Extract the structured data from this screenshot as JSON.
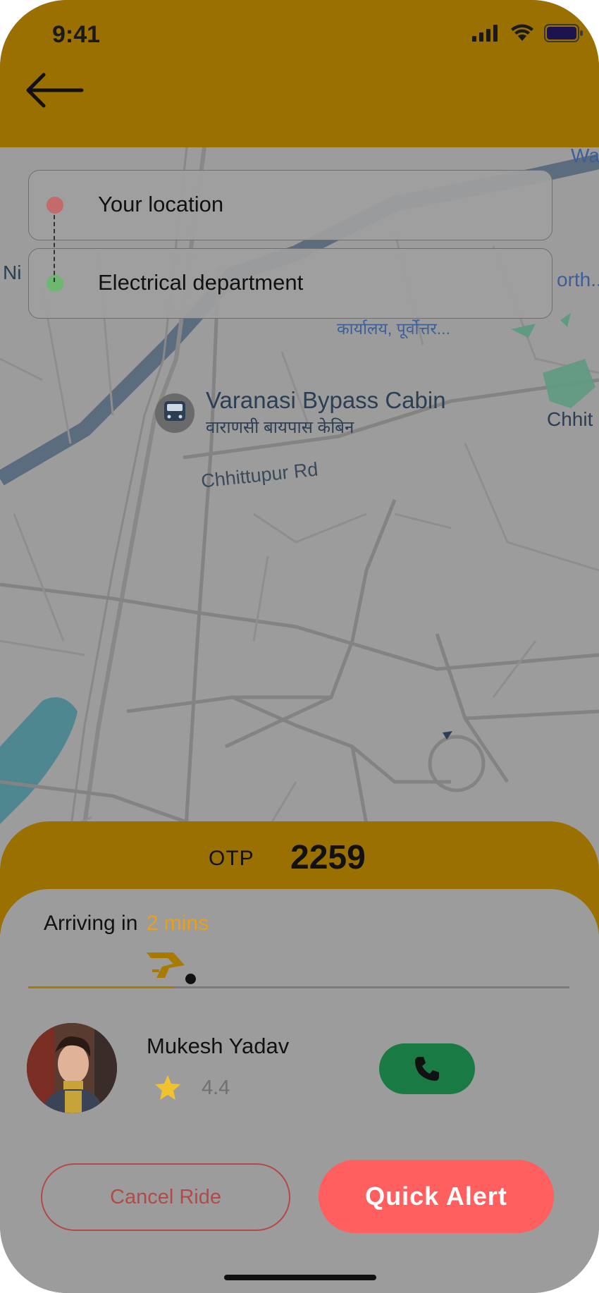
{
  "status_bar": {
    "time": "9:41"
  },
  "route": {
    "from_label": "Your location",
    "to_label": "Electrical department",
    "from_color": "#c36a6a",
    "to_color": "#6eb76e"
  },
  "map": {
    "place_name": "Varanasi Bypass Cabin",
    "place_name_local": "वाराणसी बायपास केबिन",
    "road_label": "Chhittupur Rd",
    "office_label": "कार्यालय, पूर्वोत्तर...",
    "edge_label_right": "Chhit",
    "edge_label_top": "Wa",
    "edge_label_north": "orth..",
    "edge_label_left": "Ni"
  },
  "otp": {
    "label": "OTP",
    "value": "2259"
  },
  "trip": {
    "arriving_prefix": "Arriving in",
    "arriving_eta": "2 mins",
    "progress_fraction": 0.27
  },
  "driver": {
    "name": "Mukesh Yadav",
    "rating": "4.4"
  },
  "actions": {
    "cancel_label": "Cancel Ride",
    "alert_label": "Quick Alert"
  },
  "colors": {
    "header": "#9a7000",
    "accent_eta": "#e8a018",
    "call": "#1a7a44",
    "alert": "#ff5f5f",
    "cancel": "#b24b48"
  },
  "icons": {
    "back": "arrow-left-icon",
    "call": "phone-icon",
    "rating": "star-icon",
    "vehicle": "vehicle-logo-icon",
    "station": "train-station-icon"
  }
}
